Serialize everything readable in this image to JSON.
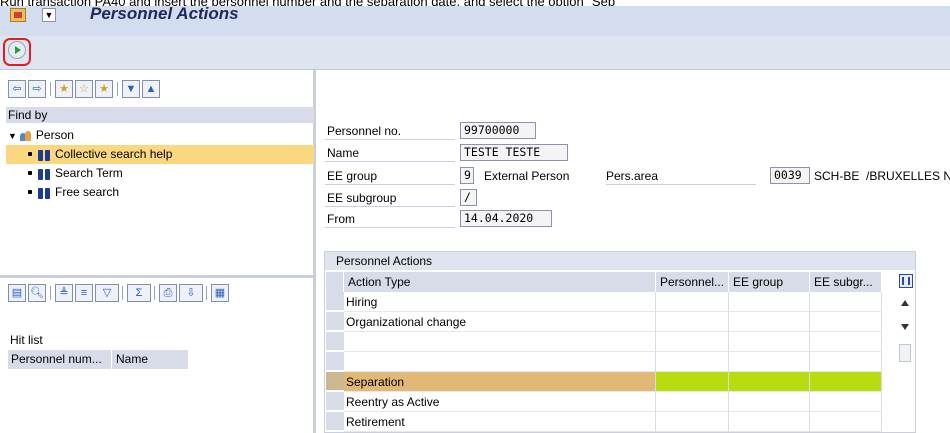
{
  "instruction_text": "Run transaction PA40 and insert the personnel number and the separation date, and select the option \"Sep",
  "window": {
    "title": "Personnel Actions"
  },
  "toolbar": {
    "execute_icon": "execute-icon"
  },
  "left_panel": {
    "find_by_label": "Find by",
    "tree": {
      "root": "Person",
      "items": [
        "Collective search help",
        "Search Term",
        "Free search"
      ]
    },
    "hit_list": {
      "label": "Hit list",
      "columns": [
        "Personnel num...",
        "Name"
      ]
    }
  },
  "header_fields": {
    "personnel_no": {
      "label": "Personnel no.",
      "value": "99700000"
    },
    "name": {
      "label": "Name",
      "value": "TESTE TESTE"
    },
    "ee_group": {
      "label": "EE group",
      "code": "9",
      "text": "External Person"
    },
    "pers_area": {
      "label": "Pers.area",
      "code": "0039",
      "text": "SCH-BE  /BRUXELLES NOH"
    },
    "ee_subgroup": {
      "label": "EE subgroup",
      "code": "/"
    },
    "from": {
      "label": "From",
      "value": "14.04.2020"
    }
  },
  "actions_table": {
    "title": "Personnel Actions",
    "columns": [
      "Action Type",
      "Personnel...",
      "EE group",
      "EE subgr..."
    ],
    "rows": [
      {
        "action": "Hiring"
      },
      {
        "action": "Organizational change"
      },
      {
        "action": ""
      },
      {
        "action": ""
      },
      {
        "action": "Separation",
        "selected": true
      },
      {
        "action": "Reentry as Active"
      },
      {
        "action": "Retirement"
      }
    ],
    "selection_color": "#b7dc10"
  }
}
